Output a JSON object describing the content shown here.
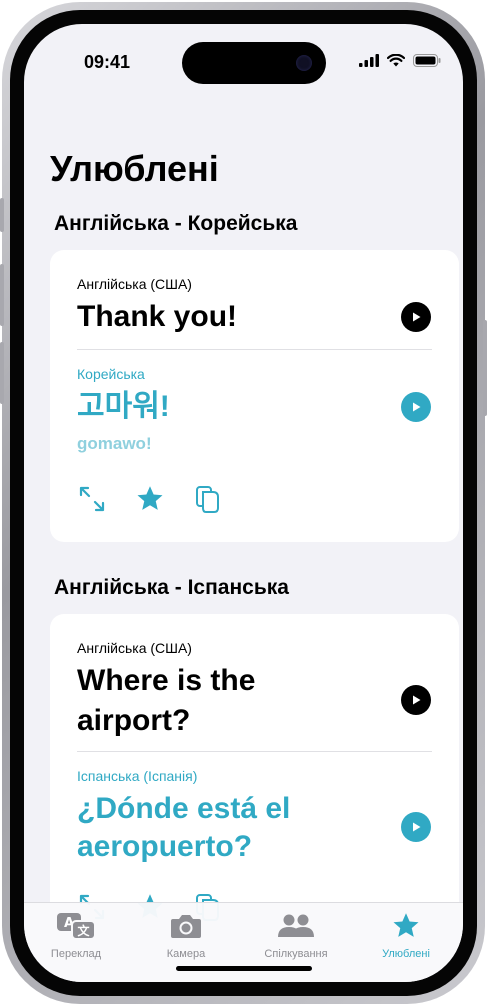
{
  "status_bar": {
    "time": "09:41"
  },
  "page": {
    "title": "Улюблені"
  },
  "groups": [
    {
      "title": "Англійська - Корейська",
      "source_lang": "Англійська (США)",
      "source_phrase": "Thank you!",
      "target_lang": "Корейська",
      "target_phrase": "고마워!",
      "transliteration": "gomawo!"
    },
    {
      "title": "Англійська - Іспанська",
      "source_lang": "Англійська (США)",
      "source_phrase_line1": "Where is the",
      "source_phrase_line2": "airport?",
      "target_lang": "Іспанська (Іспанія)",
      "target_phrase_line1": "¿Dónde está el",
      "target_phrase_line2": "aeropuerto?"
    }
  ],
  "tabbar": {
    "items": [
      {
        "label": "Переклад",
        "icon": "translate-icon"
      },
      {
        "label": "Камера",
        "icon": "camera-icon"
      },
      {
        "label": "Спілкування",
        "icon": "people-icon"
      },
      {
        "label": "Улюблені",
        "icon": "star-icon"
      }
    ]
  },
  "colors": {
    "accent": "#30a9c4",
    "background": "#f2f2f7"
  }
}
